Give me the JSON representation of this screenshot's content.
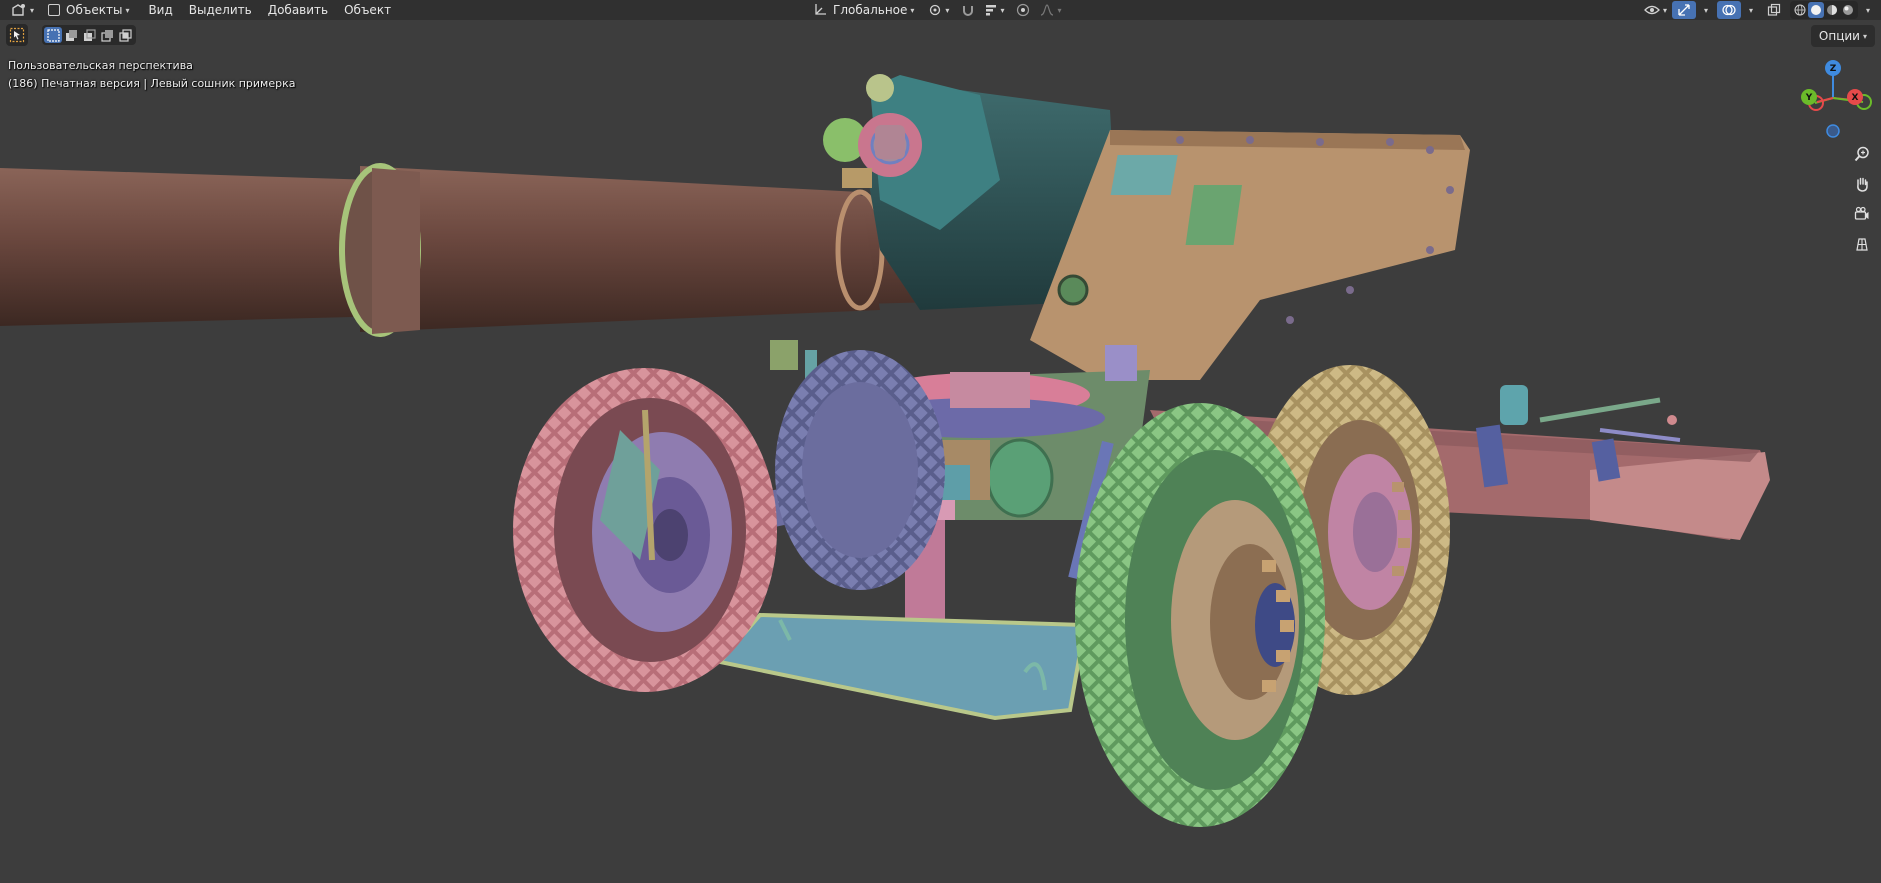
{
  "header": {
    "mode_label": "Объекты",
    "menu": [
      "Вид",
      "Выделить",
      "Добавить",
      "Объект"
    ],
    "transform_orientation": "Глобальное"
  },
  "viewport": {
    "perspective_label": "Пользовательская перспектива",
    "object_info": "(186) Печатная версия | Левый сошник примерка",
    "options_label": "Опции"
  },
  "gizmo": {
    "z": "Z",
    "y": "Y",
    "x": "X"
  },
  "icons": {
    "editor_type": "viewport-editor-icon",
    "select_tool": "select-box-icon",
    "zoom": "zoom-icon",
    "pan": "hand-icon",
    "camera": "camera-icon",
    "ortho": "grid-ortho-icon"
  },
  "colors": {
    "header_bg": "#303030",
    "viewport_bg": "#3d3d3d",
    "accent": "#4772b3",
    "axis_x": "#e64a4a",
    "axis_y": "#6bbb2a",
    "axis_z": "#3f8be0"
  }
}
